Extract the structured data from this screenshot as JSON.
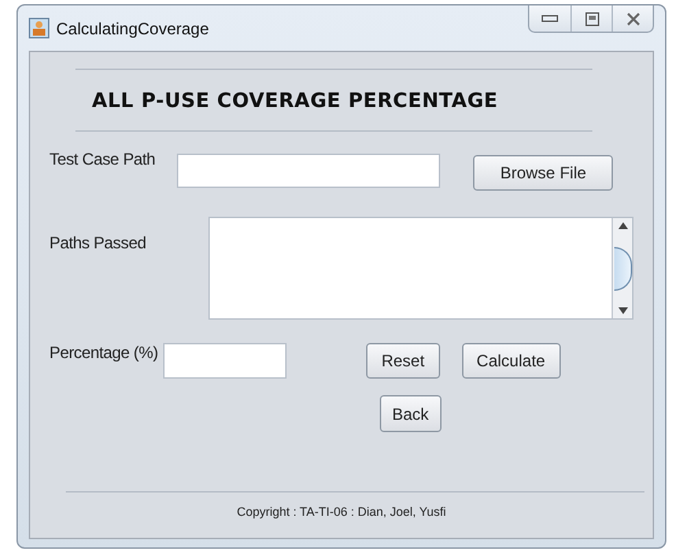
{
  "window": {
    "title": "CalculatingCoverage"
  },
  "heading": "ALL P-USE COVERAGE PERCENTAGE",
  "test_case_path": {
    "label": "Test Case Path"
  },
  "browse_button": "Browse File",
  "paths_passed": {
    "label": "Paths Passed"
  },
  "percentage": {
    "label": "Percentage (%)"
  },
  "buttons": [
    "Reset",
    "Calculate"
  ],
  "back_button": "Back",
  "footer": "Copyright : TA-TI-06 : Dian, Joel, Yusfi"
}
